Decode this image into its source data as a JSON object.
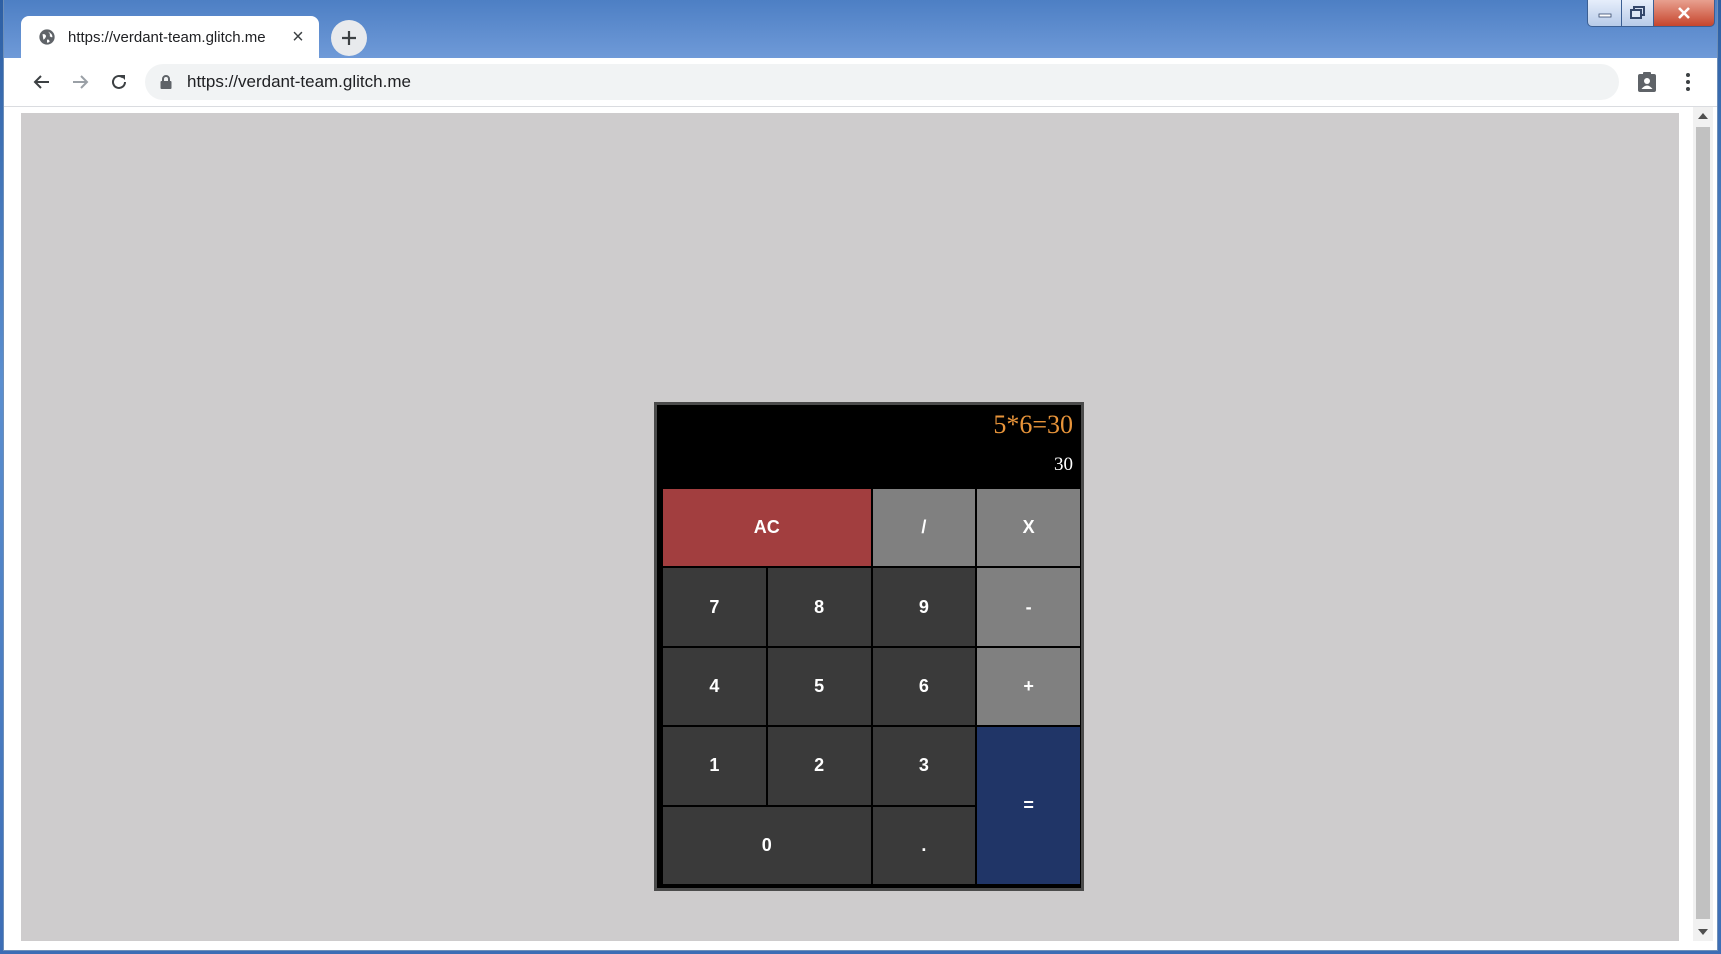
{
  "browser": {
    "tab_title": "https://verdant-team.glitch.me",
    "address": "https://verdant-team.glitch.me"
  },
  "icons": {
    "tab_favicon": "globe-icon",
    "tab_close": "close-icon",
    "new_tab": "plus-icon",
    "back": "arrow-left-icon",
    "forward": "arrow-right-icon",
    "reload": "reload-icon",
    "lock": "lock-icon",
    "profile": "profile-icon",
    "menu": "kebab-menu-icon"
  },
  "calculator": {
    "expression": "5*6=30",
    "result": "30",
    "keys": {
      "clear": "AC",
      "divide": "/",
      "multiply": "X",
      "seven": "7",
      "eight": "8",
      "nine": "9",
      "minus": "-",
      "four": "4",
      "five": "5",
      "six": "6",
      "plus": "+",
      "one": "1",
      "two": "2",
      "three": "3",
      "equals": "=",
      "zero": "0",
      "decimal": "."
    }
  },
  "colors": {
    "page_background": "#cecccd",
    "clear_key": "#a23e3f",
    "operator_key": "#808080",
    "number_key": "#3a3a3a",
    "equals_key": "#203567",
    "expression_text": "#e8943a"
  }
}
